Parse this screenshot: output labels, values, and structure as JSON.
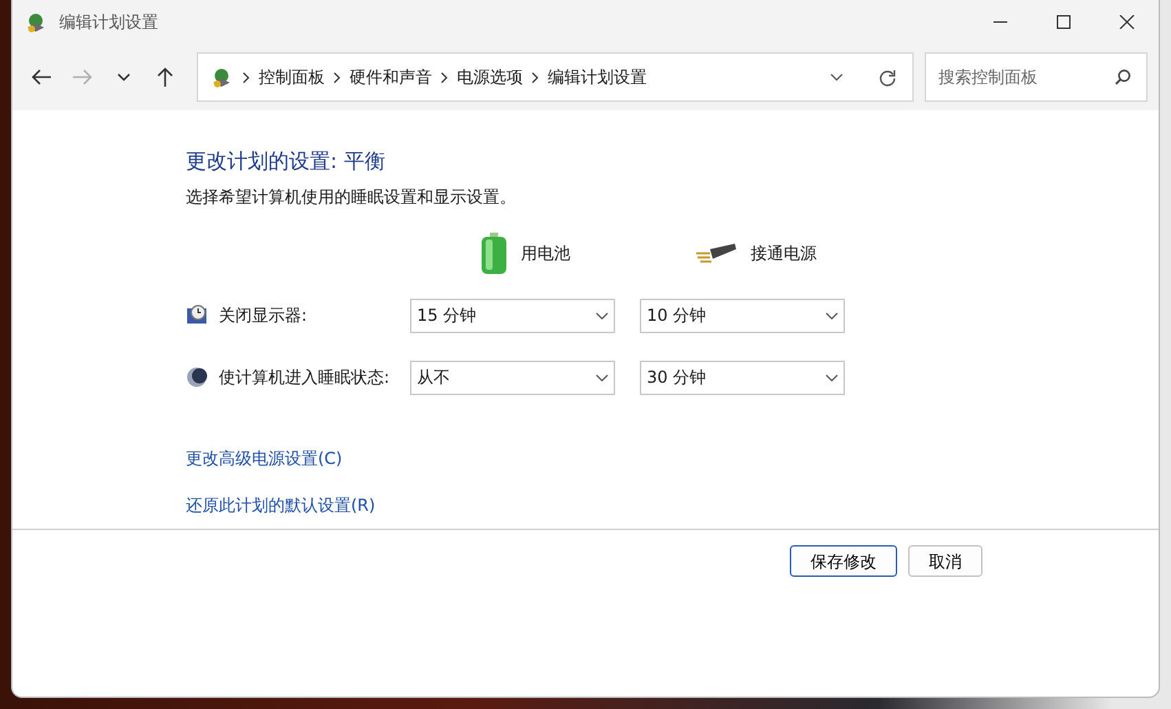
{
  "window": {
    "title": "编辑计划设置"
  },
  "nav_buttons": [
    {
      "kind": "back",
      "disabled": false
    },
    {
      "kind": "forward",
      "disabled": true
    },
    {
      "kind": "recent",
      "disabled": false
    },
    {
      "kind": "up",
      "disabled": false
    }
  ],
  "breadcrumb": [
    "控制面板",
    "硬件和声音",
    "电源选项",
    "编辑计划设置"
  ],
  "search": {
    "placeholder": "搜索控制面板"
  },
  "heading": "更改计划的设置: 平衡",
  "description": "选择希望计算机使用的睡眠设置和显示设置。",
  "columns": [
    {
      "kind": "battery",
      "label": "用电池"
    },
    {
      "kind": "plugged",
      "label": "接通电源"
    }
  ],
  "settings": [
    {
      "kind": "display",
      "label": "关闭显示器:",
      "values": [
        "15 分钟",
        "10 分钟"
      ]
    },
    {
      "kind": "sleep",
      "label": "使计算机进入睡眠状态:",
      "values": [
        "从不",
        "30 分钟"
      ]
    }
  ],
  "links": [
    "更改高级电源设置(C)",
    "还原此计划的默认设置(R)"
  ],
  "buttons": [
    {
      "label": "保存修改",
      "primary": true
    },
    {
      "label": "取消",
      "primary": false
    }
  ]
}
